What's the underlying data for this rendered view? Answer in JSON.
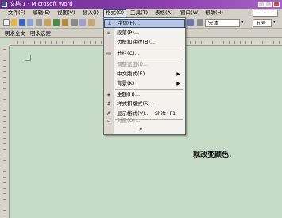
{
  "window": {
    "title": "文档 1 - Microsoft Word"
  },
  "menubar": {
    "items": [
      "文件(F)",
      "编辑(E)",
      "视图(V)",
      "插入(I)",
      "格式(O)",
      "工具(T)",
      "表格(A)",
      "窗口(W)",
      "帮助(H)"
    ],
    "active": "格式(O)"
  },
  "toolbar": {
    "font_name": "宋体",
    "font_size": "五号",
    "size_partial": "A"
  },
  "toolbar2": {
    "left_label": "明永全文",
    "right_label": "明永选定"
  },
  "format_menu": {
    "items": [
      {
        "label": "字体(F)...",
        "icon": "font-A-icon",
        "highlighted": true
      },
      {
        "label": "段落(P)...",
        "icon": "paragraph-icon"
      },
      {
        "label": "边框和底纹(B)...",
        "icon": ""
      },
      {
        "label": "分栏(C)...",
        "icon": "columns-icon"
      },
      {
        "label": "调整宽度(I)...",
        "icon": "",
        "disabled": true
      },
      {
        "label": "中文版式(E)",
        "icon": "",
        "submenu": true
      },
      {
        "label": "背景(K)",
        "icon": "",
        "submenu": true
      },
      {
        "label": "主题(H)...",
        "icon": "theme-icon"
      },
      {
        "label": "样式和格式(S)...",
        "icon": "styles-icon"
      },
      {
        "label": "显示格式(V)...",
        "icon": "reveal-format-icon",
        "shortcut": "Shift+F1"
      },
      {
        "label": "对象(O)...",
        "icon": "",
        "disabled": true
      }
    ],
    "expand_glyph": "»"
  },
  "document": {
    "visible_text": "就改变颜色."
  }
}
